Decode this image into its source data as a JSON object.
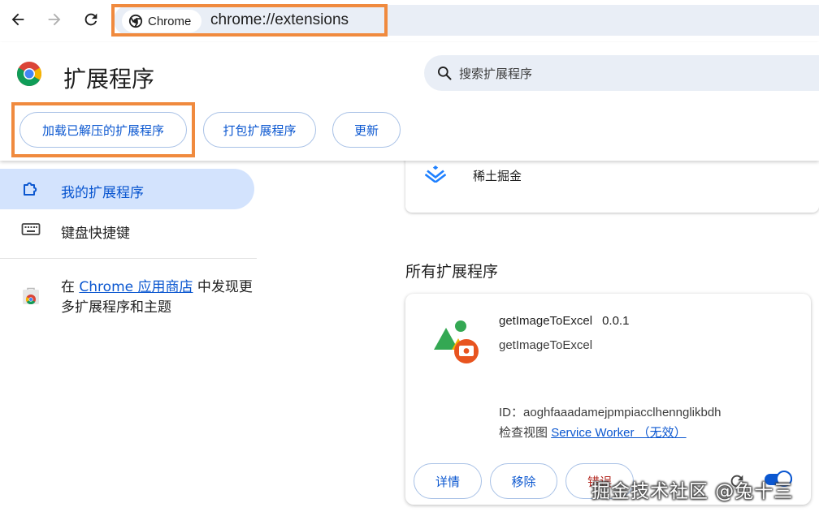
{
  "browser": {
    "chip_label": "Chrome",
    "url": "chrome://extensions"
  },
  "header": {
    "title": "扩展程序",
    "search_placeholder": "搜索扩展程序",
    "buttons": {
      "load_unpacked": "加载已解压的扩展程序",
      "pack": "打包扩展程序",
      "update": "更新"
    }
  },
  "sidebar": {
    "items": [
      {
        "label": "我的扩展程序",
        "icon": "extension-puzzle-icon",
        "active": true
      },
      {
        "label": "键盘快捷键",
        "icon": "keyboard-icon",
        "active": false
      }
    ],
    "store": {
      "prefix": "在 ",
      "link": "Chrome 应用商店",
      "suffix": " 中发现更多扩展程序和主题"
    }
  },
  "pinned_extension": {
    "name": "稀土掘金",
    "icon": "juejin-logo-icon"
  },
  "all_extensions": {
    "section_title": "所有扩展程序",
    "items": [
      {
        "name": "getImageToExcel",
        "version": "0.0.1",
        "description": "getImageToExcel",
        "id_label": "ID：",
        "id": "aoghfaaadamejpmpiacclhennglikbdh",
        "inspect_label": "检查视图",
        "inspect_link": "Service Worker （无效）",
        "buttons": {
          "details": "详情",
          "remove": "移除",
          "errors": "错误"
        },
        "enabled": true
      }
    ]
  },
  "watermark": "掘金技术社区 @兔十三",
  "colors": {
    "accent": "#0b57d0",
    "highlight": "#f08a3e",
    "active_bg": "#d3e3fd",
    "omnibox_bg": "#e9eef6",
    "error": "#b3261e"
  }
}
